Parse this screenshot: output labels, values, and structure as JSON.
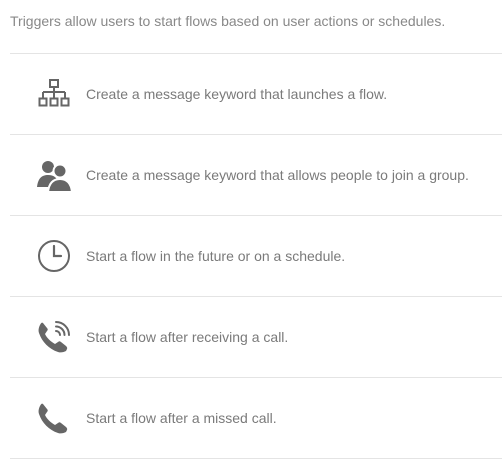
{
  "intro": {
    "text": "Triggers allow users to start flows based on user actions or schedules."
  },
  "triggers": [
    {
      "icon": "flow-tree-icon",
      "label": "Create a message keyword that launches a flow."
    },
    {
      "icon": "group-join-icon",
      "label": "Create a message keyword that allows people to join a group."
    },
    {
      "icon": "clock-icon",
      "label": "Start a flow in the future or on a schedule."
    },
    {
      "icon": "incoming-call-icon",
      "label": "Start a flow after receiving a call."
    },
    {
      "icon": "missed-call-icon",
      "label": "Start a flow after a missed call."
    }
  ],
  "colors": {
    "icon": "#666666",
    "text": "#7a7a7a",
    "divider": "#e4e4e4"
  }
}
